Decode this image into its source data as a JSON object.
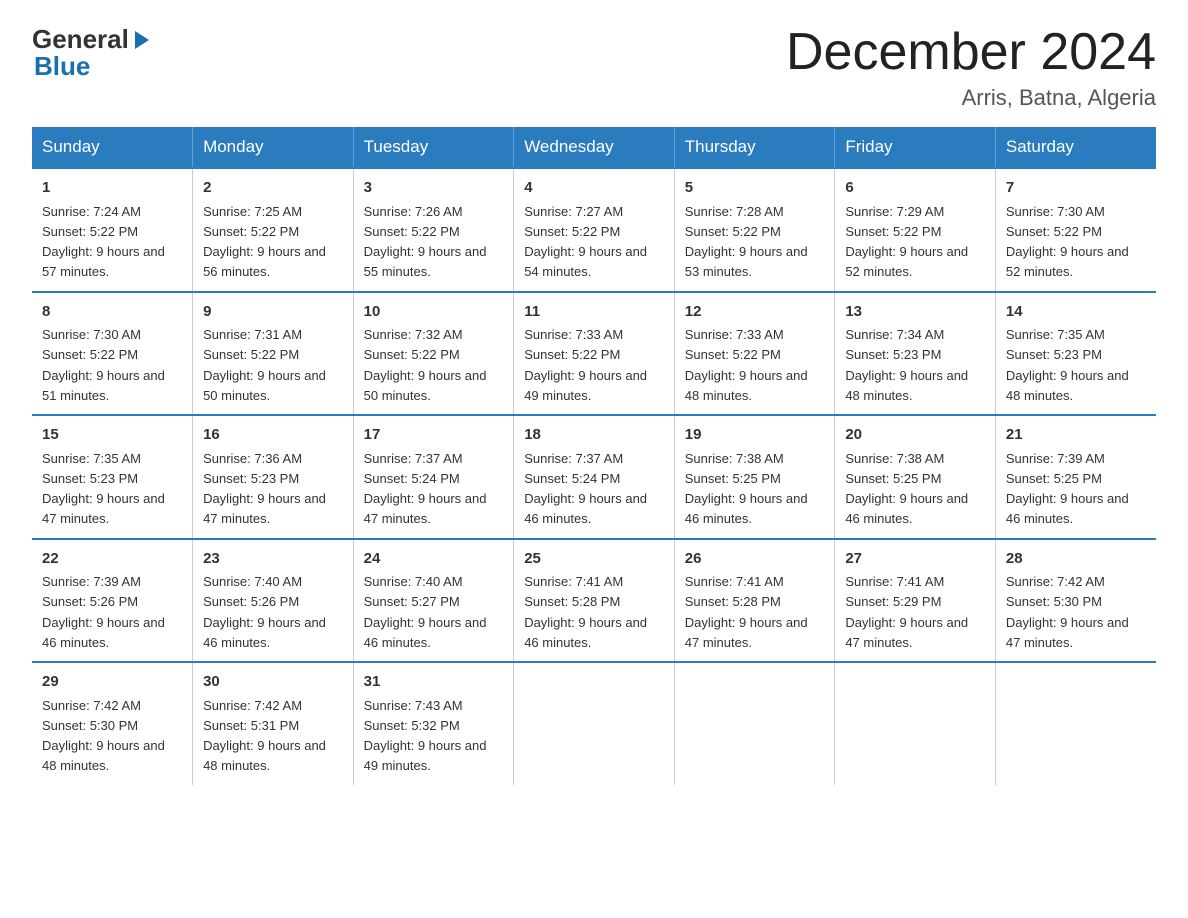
{
  "header": {
    "logo_general": "General",
    "logo_blue": "Blue",
    "title": "December 2024",
    "subtitle": "Arris, Batna, Algeria"
  },
  "days_of_week": [
    "Sunday",
    "Monday",
    "Tuesday",
    "Wednesday",
    "Thursday",
    "Friday",
    "Saturday"
  ],
  "weeks": [
    [
      {
        "day": "1",
        "sunrise": "7:24 AM",
        "sunset": "5:22 PM",
        "daylight": "9 hours and 57 minutes."
      },
      {
        "day": "2",
        "sunrise": "7:25 AM",
        "sunset": "5:22 PM",
        "daylight": "9 hours and 56 minutes."
      },
      {
        "day": "3",
        "sunrise": "7:26 AM",
        "sunset": "5:22 PM",
        "daylight": "9 hours and 55 minutes."
      },
      {
        "day": "4",
        "sunrise": "7:27 AM",
        "sunset": "5:22 PM",
        "daylight": "9 hours and 54 minutes."
      },
      {
        "day": "5",
        "sunrise": "7:28 AM",
        "sunset": "5:22 PM",
        "daylight": "9 hours and 53 minutes."
      },
      {
        "day": "6",
        "sunrise": "7:29 AM",
        "sunset": "5:22 PM",
        "daylight": "9 hours and 52 minutes."
      },
      {
        "day": "7",
        "sunrise": "7:30 AM",
        "sunset": "5:22 PM",
        "daylight": "9 hours and 52 minutes."
      }
    ],
    [
      {
        "day": "8",
        "sunrise": "7:30 AM",
        "sunset": "5:22 PM",
        "daylight": "9 hours and 51 minutes."
      },
      {
        "day": "9",
        "sunrise": "7:31 AM",
        "sunset": "5:22 PM",
        "daylight": "9 hours and 50 minutes."
      },
      {
        "day": "10",
        "sunrise": "7:32 AM",
        "sunset": "5:22 PM",
        "daylight": "9 hours and 50 minutes."
      },
      {
        "day": "11",
        "sunrise": "7:33 AM",
        "sunset": "5:22 PM",
        "daylight": "9 hours and 49 minutes."
      },
      {
        "day": "12",
        "sunrise": "7:33 AM",
        "sunset": "5:22 PM",
        "daylight": "9 hours and 48 minutes."
      },
      {
        "day": "13",
        "sunrise": "7:34 AM",
        "sunset": "5:23 PM",
        "daylight": "9 hours and 48 minutes."
      },
      {
        "day": "14",
        "sunrise": "7:35 AM",
        "sunset": "5:23 PM",
        "daylight": "9 hours and 48 minutes."
      }
    ],
    [
      {
        "day": "15",
        "sunrise": "7:35 AM",
        "sunset": "5:23 PM",
        "daylight": "9 hours and 47 minutes."
      },
      {
        "day": "16",
        "sunrise": "7:36 AM",
        "sunset": "5:23 PM",
        "daylight": "9 hours and 47 minutes."
      },
      {
        "day": "17",
        "sunrise": "7:37 AM",
        "sunset": "5:24 PM",
        "daylight": "9 hours and 47 minutes."
      },
      {
        "day": "18",
        "sunrise": "7:37 AM",
        "sunset": "5:24 PM",
        "daylight": "9 hours and 46 minutes."
      },
      {
        "day": "19",
        "sunrise": "7:38 AM",
        "sunset": "5:25 PM",
        "daylight": "9 hours and 46 minutes."
      },
      {
        "day": "20",
        "sunrise": "7:38 AM",
        "sunset": "5:25 PM",
        "daylight": "9 hours and 46 minutes."
      },
      {
        "day": "21",
        "sunrise": "7:39 AM",
        "sunset": "5:25 PM",
        "daylight": "9 hours and 46 minutes."
      }
    ],
    [
      {
        "day": "22",
        "sunrise": "7:39 AM",
        "sunset": "5:26 PM",
        "daylight": "9 hours and 46 minutes."
      },
      {
        "day": "23",
        "sunrise": "7:40 AM",
        "sunset": "5:26 PM",
        "daylight": "9 hours and 46 minutes."
      },
      {
        "day": "24",
        "sunrise": "7:40 AM",
        "sunset": "5:27 PM",
        "daylight": "9 hours and 46 minutes."
      },
      {
        "day": "25",
        "sunrise": "7:41 AM",
        "sunset": "5:28 PM",
        "daylight": "9 hours and 46 minutes."
      },
      {
        "day": "26",
        "sunrise": "7:41 AM",
        "sunset": "5:28 PM",
        "daylight": "9 hours and 47 minutes."
      },
      {
        "day": "27",
        "sunrise": "7:41 AM",
        "sunset": "5:29 PM",
        "daylight": "9 hours and 47 minutes."
      },
      {
        "day": "28",
        "sunrise": "7:42 AM",
        "sunset": "5:30 PM",
        "daylight": "9 hours and 47 minutes."
      }
    ],
    [
      {
        "day": "29",
        "sunrise": "7:42 AM",
        "sunset": "5:30 PM",
        "daylight": "9 hours and 48 minutes."
      },
      {
        "day": "30",
        "sunrise": "7:42 AM",
        "sunset": "5:31 PM",
        "daylight": "9 hours and 48 minutes."
      },
      {
        "day": "31",
        "sunrise": "7:43 AM",
        "sunset": "5:32 PM",
        "daylight": "9 hours and 49 minutes."
      },
      null,
      null,
      null,
      null
    ]
  ]
}
